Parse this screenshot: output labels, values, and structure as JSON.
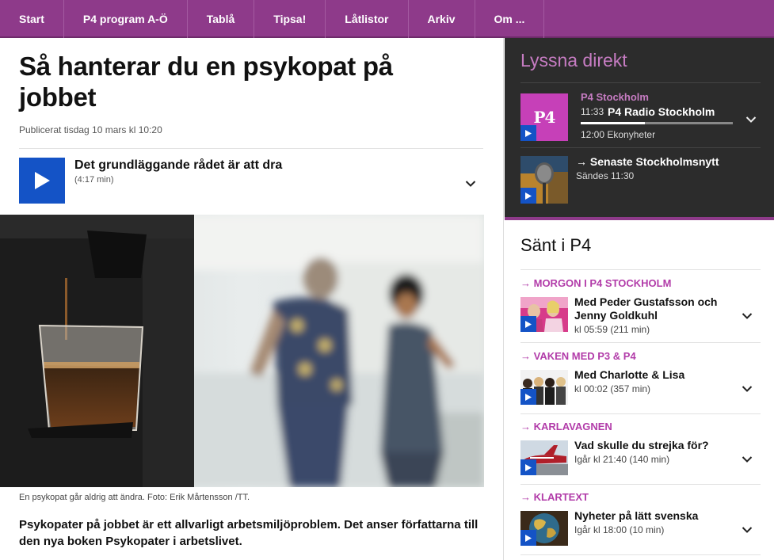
{
  "nav": {
    "items": [
      "Start",
      "P4 program A-Ö",
      "Tablå",
      "Tipsa!",
      "Låtlistor",
      "Arkiv",
      "Om ..."
    ]
  },
  "article": {
    "title": "Så hanterar du en psykopat på jobbet",
    "published": "Publicerat tisdag 10 mars kl 10:20",
    "audio": {
      "title": "Det grundläggande rådet är att dra",
      "duration": "(4:17 min)"
    },
    "caption": "En psykopat går aldrig att ändra. Foto: Erik Mårtensson /TT.",
    "lead": "Psykopater på jobbet är ett allvarligt arbetsmiljöproblem. Det anser författarna till den nya boken Psykopater i arbetslivet."
  },
  "live": {
    "title": "Lyssna direkt",
    "logo_text": "P4",
    "station": "P4 Stockholm",
    "now_time": "11:33",
    "now_program": "P4 Radio Stockholm",
    "progress": 0.42,
    "next": "12:00 Ekonyheter",
    "news_title": "→ Senaste Stockholmsnytt",
    "news_sub": "Sändes 11:30"
  },
  "sent": {
    "title": "Sänt i P4",
    "items": [
      {
        "head": "→ MORGON I P4 STOCKHOLM",
        "title": "Med Peder Gustafsson och Jenny Goldkuhl",
        "meta": "kl 05:59  (211 min)"
      },
      {
        "head": "→ VAKEN MED P3 & P4",
        "title": "Med Charlotte & Lisa",
        "meta": "kl 00:02  (357 min)"
      },
      {
        "head": "→ KARLAVAGNEN",
        "title": "Vad skulle du strejka för?",
        "meta": "Igår kl 21:40  (140 min)"
      },
      {
        "head": "→ KLARTEXT",
        "title": "Nyheter på lätt svenska",
        "meta": "Igår kl 18:00  (10 min)"
      }
    ]
  },
  "colors": {
    "brand": "#8e3a8a",
    "accent": "#b23ca9",
    "play": "#1453c6",
    "live_bg": "#2c2c2c"
  },
  "icons": [
    "play-icon",
    "chevron-down-icon",
    "p4-logo",
    "microphone-thumbnail"
  ]
}
